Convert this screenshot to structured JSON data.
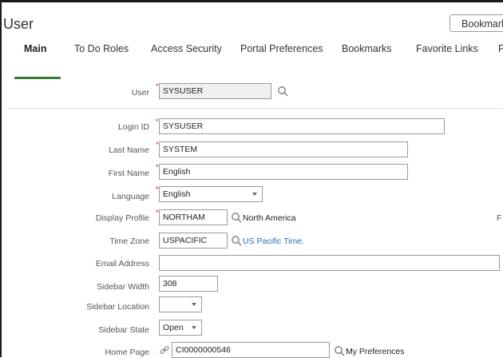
{
  "header": {
    "title": "User",
    "bookmark_button": "Bookmark"
  },
  "tabs": [
    {
      "label": "Main",
      "active": true
    },
    {
      "label": "To Do Roles",
      "active": false
    },
    {
      "label": "Access Security",
      "active": false
    },
    {
      "label": "Portal Preferences",
      "active": false
    },
    {
      "label": "Bookmarks",
      "active": false
    },
    {
      "label": "Favorite Links",
      "active": false
    },
    {
      "label": "F",
      "active": false
    }
  ],
  "form": {
    "user": {
      "label": "User",
      "value": "SYSUSER"
    },
    "login_id": {
      "label": "Login ID",
      "value": "SYSUSER"
    },
    "last_name": {
      "label": "Last Name",
      "value": "SYSTEM"
    },
    "first_name": {
      "label": "First Name",
      "value": "English"
    },
    "language": {
      "label": "Language",
      "value": "English"
    },
    "display_profile": {
      "label": "Display Profile",
      "value": "NORTHAM",
      "description": "North America",
      "right_fragment": "F"
    },
    "time_zone": {
      "label": "Time Zone",
      "value": "USPACIFIC",
      "description": "US Pacific Time."
    },
    "email_address": {
      "label": "Email Address",
      "value": ""
    },
    "sidebar_width": {
      "label": "Sidebar Width",
      "value": "308"
    },
    "sidebar_location": {
      "label": "Sidebar Location",
      "value": ""
    },
    "sidebar_state": {
      "label": "Sidebar State",
      "value": "Open"
    },
    "home_page": {
      "label": "Home Page",
      "value": "CI0000000546",
      "description": "My Preferences"
    }
  },
  "colors": {
    "required": "#c8232c",
    "active_tab": "#3d7a3d",
    "link": "#2a6ebb"
  },
  "icons": {
    "search": "search-icon",
    "dropdown": "chevron-down-icon",
    "link": "link-icon"
  }
}
